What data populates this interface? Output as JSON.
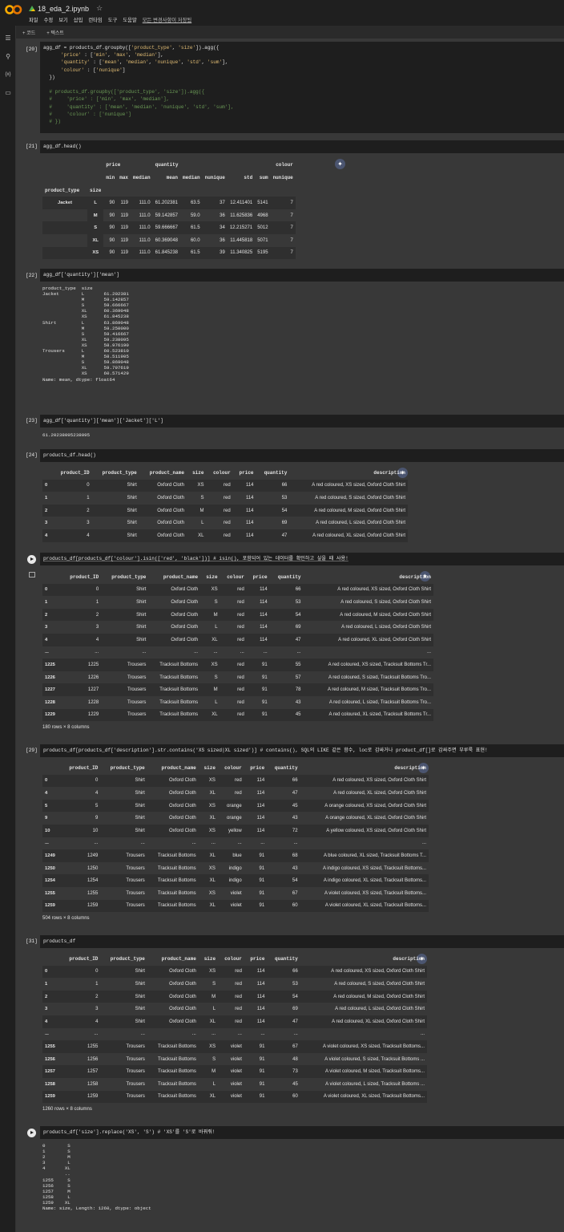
{
  "file": {
    "name": "18_eda_2.ipynb"
  },
  "menu": [
    "파일",
    "수정",
    "보기",
    "삽입",
    "런타임",
    "도구",
    "도움말"
  ],
  "saved": "모든 변경사항이 저장됨",
  "toolbar": {
    "code": "+ 코드",
    "text": "+ 텍스트"
  },
  "cells": {
    "c20": {
      "count": "[20]"
    },
    "c21": {
      "count": "[21]",
      "code": "agg_df.head()"
    },
    "c22": {
      "count": "[22]",
      "code": "agg_df['quantity']['mean']"
    },
    "c23": {
      "count": "[23]",
      "code": "agg_df['quantity']['mean']['Jacket']['L']",
      "out": "61.20238095238095"
    },
    "c24": {
      "count": "[24]",
      "code": "products_df.head()"
    },
    "c25": {
      "code": "products_df[products_df['colour'].isin(['red', 'black'])] # isin(), 포함되어 있는 데이터를 확인하고 싶을 때 사용!",
      "rows": "180 rows × 8 columns"
    },
    "c29": {
      "count": "[29]",
      "code": "products_df[products_df['description'].str.contains('XS sized|XL sized')] # contains(), SQL의 LIKE 같은 함수, loc로 감싸거나 product_df[]로 감싸주면 부루룩 표현!",
      "rows": "504 rows × 8 columns"
    },
    "c31": {
      "count": "[31]",
      "code": "products_df",
      "rows": "1260 rows × 8 columns"
    },
    "c32": {
      "code": "products_df['size'].replace('XS', 'S') # 'XS'를 'S'로 바꿔줘!"
    }
  },
  "agg": {
    "top": [
      "price",
      "quantity",
      "colour"
    ],
    "sub": [
      "min",
      "max",
      "median",
      "mean",
      "median",
      "nunique",
      "std",
      "sum",
      "nunique"
    ],
    "idx": [
      "product_type",
      "size"
    ],
    "group": "Jacket",
    "rows": [
      [
        "L",
        "90",
        "119",
        "111.0",
        "61.202381",
        "63.5",
        "37",
        "12.411401",
        "5141",
        "7"
      ],
      [
        "M",
        "90",
        "119",
        "111.0",
        "59.142857",
        "59.0",
        "36",
        "11.625836",
        "4968",
        "7"
      ],
      [
        "S",
        "90",
        "119",
        "111.0",
        "59.666667",
        "61.5",
        "34",
        "12.215271",
        "5012",
        "7"
      ],
      [
        "XL",
        "90",
        "119",
        "111.0",
        "60.369048",
        "60.0",
        "36",
        "11.445818",
        "5071",
        "7"
      ],
      [
        "XS",
        "90",
        "119",
        "111.0",
        "61.845238",
        "61.5",
        "39",
        "11.340825",
        "5195",
        "7"
      ]
    ]
  },
  "series22": "product_type  size\nJacket        L       61.202381\n              M       59.142857\n              S       59.666667\n              XL      60.369048\n              XS      61.845238\nShirt         L       63.869048\n              M       59.250000\n              S       59.416667\n              XL      59.238095\n              XS      58.976190\nTrousers      L       60.523810\n              M       58.511905\n              S       59.869048\n              XL      59.797619\n              XS      60.571429\nName: mean, dtype: float64",
  "series32": "0        S\n1        S\n2        M\n3        L\n4       XL\n        ..\n1255     S\n1256     S\n1257     M\n1258     L\n1259    XL\nName: size, Length: 1260, dtype: object",
  "cols": [
    "product_ID",
    "product_type",
    "product_name",
    "size",
    "colour",
    "price",
    "quantity",
    "description"
  ],
  "t24": [
    [
      "0",
      "0",
      "Shirt",
      "Oxford Cloth",
      "XS",
      "red",
      "114",
      "66",
      "A red coloured, XS sized, Oxford Cloth Shirt"
    ],
    [
      "1",
      "1",
      "Shirt",
      "Oxford Cloth",
      "S",
      "red",
      "114",
      "53",
      "A red coloured, S sized, Oxford Cloth Shirt"
    ],
    [
      "2",
      "2",
      "Shirt",
      "Oxford Cloth",
      "M",
      "red",
      "114",
      "54",
      "A red coloured, M sized, Oxford Cloth Shirt"
    ],
    [
      "3",
      "3",
      "Shirt",
      "Oxford Cloth",
      "L",
      "red",
      "114",
      "69",
      "A red coloured, L sized, Oxford Cloth Shirt"
    ],
    [
      "4",
      "4",
      "Shirt",
      "Oxford Cloth",
      "XL",
      "red",
      "114",
      "47",
      "A red coloured, XL sized, Oxford Cloth Shirt"
    ]
  ],
  "t25": [
    [
      "0",
      "0",
      "Shirt",
      "Oxford Cloth",
      "XS",
      "red",
      "114",
      "66",
      "A red coloured, XS sized, Oxford Cloth Shirt"
    ],
    [
      "1",
      "1",
      "Shirt",
      "Oxford Cloth",
      "S",
      "red",
      "114",
      "53",
      "A red coloured, S sized, Oxford Cloth Shirt"
    ],
    [
      "2",
      "2",
      "Shirt",
      "Oxford Cloth",
      "M",
      "red",
      "114",
      "54",
      "A red coloured, M sized, Oxford Cloth Shirt"
    ],
    [
      "3",
      "3",
      "Shirt",
      "Oxford Cloth",
      "L",
      "red",
      "114",
      "69",
      "A red coloured, L sized, Oxford Cloth Shirt"
    ],
    [
      "4",
      "4",
      "Shirt",
      "Oxford Cloth",
      "XL",
      "red",
      "114",
      "47",
      "A red coloured, XL sized, Oxford Cloth Shirt"
    ],
    [
      "...",
      "...",
      "...",
      "...",
      "...",
      "...",
      "...",
      "...",
      "..."
    ],
    [
      "1225",
      "1225",
      "Trousers",
      "Tracksuit Bottoms",
      "XS",
      "red",
      "91",
      "55",
      "A red coloured, XS sized, Tracksuit Bottoms Tr..."
    ],
    [
      "1226",
      "1226",
      "Trousers",
      "Tracksuit Bottoms",
      "S",
      "red",
      "91",
      "57",
      "A red coloured, S sized, Tracksuit Bottoms Tro..."
    ],
    [
      "1227",
      "1227",
      "Trousers",
      "Tracksuit Bottoms",
      "M",
      "red",
      "91",
      "78",
      "A red coloured, M sized, Tracksuit Bottoms Tro..."
    ],
    [
      "1228",
      "1228",
      "Trousers",
      "Tracksuit Bottoms",
      "L",
      "red",
      "91",
      "43",
      "A red coloured, L sized, Tracksuit Bottoms Tro..."
    ],
    [
      "1229",
      "1229",
      "Trousers",
      "Tracksuit Bottoms",
      "XL",
      "red",
      "91",
      "45",
      "A red coloured, XL sized, Tracksuit Bottoms Tr..."
    ]
  ],
  "t29": [
    [
      "0",
      "0",
      "Shirt",
      "Oxford Cloth",
      "XS",
      "red",
      "114",
      "66",
      "A red coloured, XS sized, Oxford Cloth Shirt"
    ],
    [
      "4",
      "4",
      "Shirt",
      "Oxford Cloth",
      "XL",
      "red",
      "114",
      "47",
      "A red coloured, XL sized, Oxford Cloth Shirt"
    ],
    [
      "5",
      "5",
      "Shirt",
      "Oxford Cloth",
      "XS",
      "orange",
      "114",
      "45",
      "A orange coloured, XS sized, Oxford Cloth Shirt"
    ],
    [
      "9",
      "9",
      "Shirt",
      "Oxford Cloth",
      "XL",
      "orange",
      "114",
      "43",
      "A orange coloured, XL sized, Oxford Cloth Shirt"
    ],
    [
      "10",
      "10",
      "Shirt",
      "Oxford Cloth",
      "XS",
      "yellow",
      "114",
      "72",
      "A yellow coloured, XS sized, Oxford Cloth Shirt"
    ],
    [
      "...",
      "...",
      "...",
      "...",
      "...",
      "...",
      "...",
      "...",
      "..."
    ],
    [
      "1249",
      "1249",
      "Trousers",
      "Tracksuit Bottoms",
      "XL",
      "blue",
      "91",
      "68",
      "A blue coloured, XL sized, Tracksuit Bottoms T..."
    ],
    [
      "1250",
      "1250",
      "Trousers",
      "Tracksuit Bottoms",
      "XS",
      "indigo",
      "91",
      "43",
      "A indigo coloured, XS sized, Tracksuit Bottoms..."
    ],
    [
      "1254",
      "1254",
      "Trousers",
      "Tracksuit Bottoms",
      "XL",
      "indigo",
      "91",
      "54",
      "A indigo coloured, XL sized, Tracksuit Bottoms..."
    ],
    [
      "1255",
      "1255",
      "Trousers",
      "Tracksuit Bottoms",
      "XS",
      "violet",
      "91",
      "67",
      "A violet coloured, XS sized, Tracksuit Bottoms..."
    ],
    [
      "1259",
      "1259",
      "Trousers",
      "Tracksuit Bottoms",
      "XL",
      "violet",
      "91",
      "60",
      "A violet coloured, XL sized, Tracksuit Bottoms..."
    ]
  ],
  "t31": [
    [
      "0",
      "0",
      "Shirt",
      "Oxford Cloth",
      "XS",
      "red",
      "114",
      "66",
      "A red coloured, XS sized, Oxford Cloth Shirt"
    ],
    [
      "1",
      "1",
      "Shirt",
      "Oxford Cloth",
      "S",
      "red",
      "114",
      "53",
      "A red coloured, S sized, Oxford Cloth Shirt"
    ],
    [
      "2",
      "2",
      "Shirt",
      "Oxford Cloth",
      "M",
      "red",
      "114",
      "54",
      "A red coloured, M sized, Oxford Cloth Shirt"
    ],
    [
      "3",
      "3",
      "Shirt",
      "Oxford Cloth",
      "L",
      "red",
      "114",
      "69",
      "A red coloured, L sized, Oxford Cloth Shirt"
    ],
    [
      "4",
      "4",
      "Shirt",
      "Oxford Cloth",
      "XL",
      "red",
      "114",
      "47",
      "A red coloured, XL sized, Oxford Cloth Shirt"
    ],
    [
      "...",
      "...",
      "...",
      "...",
      "...",
      "...",
      "...",
      "...",
      "..."
    ],
    [
      "1255",
      "1255",
      "Trousers",
      "Tracksuit Bottoms",
      "XS",
      "violet",
      "91",
      "67",
      "A violet coloured, XS sized, Tracksuit Bottoms..."
    ],
    [
      "1256",
      "1256",
      "Trousers",
      "Tracksuit Bottoms",
      "S",
      "violet",
      "91",
      "48",
      "A violet coloured, S sized, Tracksuit Bottoms ..."
    ],
    [
      "1257",
      "1257",
      "Trousers",
      "Tracksuit Bottoms",
      "M",
      "violet",
      "91",
      "73",
      "A violet coloured, M sized, Tracksuit Bottoms..."
    ],
    [
      "1258",
      "1258",
      "Trousers",
      "Tracksuit Bottoms",
      "L",
      "violet",
      "91",
      "45",
      "A violet coloured, L sized, Tracksuit Bottoms ..."
    ],
    [
      "1259",
      "1259",
      "Trousers",
      "Tracksuit Bottoms",
      "XL",
      "violet",
      "91",
      "60",
      "A violet coloured, XL sized, Tracksuit Bottoms..."
    ]
  ]
}
